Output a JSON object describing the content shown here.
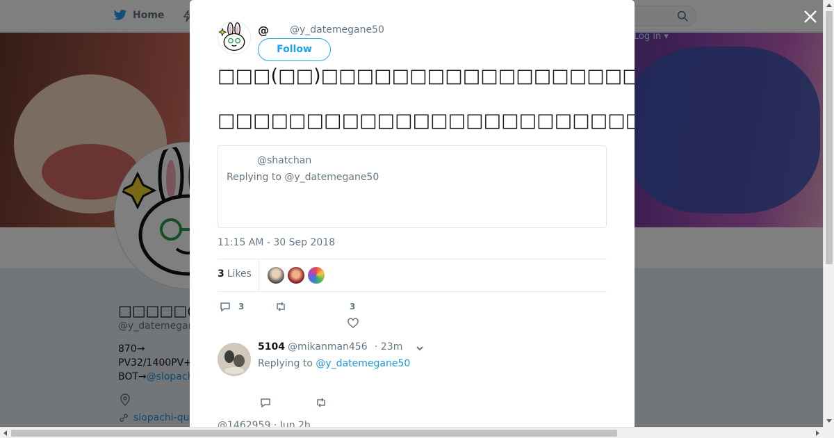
{
  "topbar": {
    "home_label": "Home",
    "login_label": "Log in",
    "icons": [
      "twitter-bird-icon",
      "bolt-icon",
      "search-icon"
    ]
  },
  "profile": {
    "name": "□□□□□@□□",
    "handle": "@y_datemegane",
    "bio_lines": [
      "870→",
      "PV32/1400PV+",
      "BOT→"
    ],
    "bio_link": "@slopach",
    "website": "slopachi-qu"
  },
  "modal": {
    "close_icon": "close-icon",
    "tweet": {
      "name": "@",
      "handle": "@y_datemegane50",
      "follow_label": "Follow",
      "text_line1": "□□□(□□)□□□□□□□□□□□□□□□□□□□□□□□□□□□□□□□□□□□□□□□□□□□□□□",
      "text_line2": "□□□□□□□□□□□□□□□□□□□□□□□□□□□□□□□□□□□□□□□□□□□□□□□□□□□□",
      "quote": {
        "handle": "@shatchan",
        "replying_to": "Replying to @y_datemegane50"
      },
      "timestamp": "11:15 AM - 30 Sep 2018",
      "likes_count": "3",
      "likes_label": "Likes",
      "reply_count": "3",
      "like_count_action": "3"
    },
    "reply": {
      "name": "5104",
      "handle": "@mikanman456",
      "time": "· 23m",
      "replying_prefix": "Replying to",
      "replying_handle": "@y_datemegane50"
    },
    "next_reply_partial": "@1462959 · Jun 2h"
  },
  "colors": {
    "accent": "#1da1f2",
    "link": "#1b95e0",
    "text_secondary": "#657786"
  }
}
